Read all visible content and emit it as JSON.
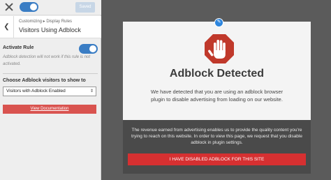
{
  "topbar": {
    "close_icon": "close-icon",
    "saved_label": "Saved",
    "toggle_on": true,
    "accent_color": "#3a7dc4"
  },
  "section": {
    "back_icon": "chevron-left-icon",
    "breadcrumb": "Customizing ▸ Display Rules",
    "title": "Visitors Using Adblock"
  },
  "rule": {
    "label": "Activate Rule",
    "enabled": true,
    "description": "Adblock detection will not work if this rule is not activated."
  },
  "choose": {
    "label": "Choose Adblock visitors to show to",
    "selected": "Visitors with Adblock Enabled"
  },
  "doc_button": {
    "label": "View Documentation",
    "color": "#d9534f"
  },
  "modal": {
    "edit_icon": "pencil-icon",
    "stop_icon": "stop-hand-icon",
    "title": "Adblock Detected",
    "message": "We have detected that you are using an adblock browser plugin to disable advertising from loading on our website.",
    "notice": "The revenue earned from advertising enables us to provide the quality content you're trying to reach on this website. In order to view this page, we request that you disable adblock in plugin settings.",
    "button_label": "I HAVE DISABLED ADBLOCK FOR THIS SITE",
    "button_color": "#d63031"
  }
}
